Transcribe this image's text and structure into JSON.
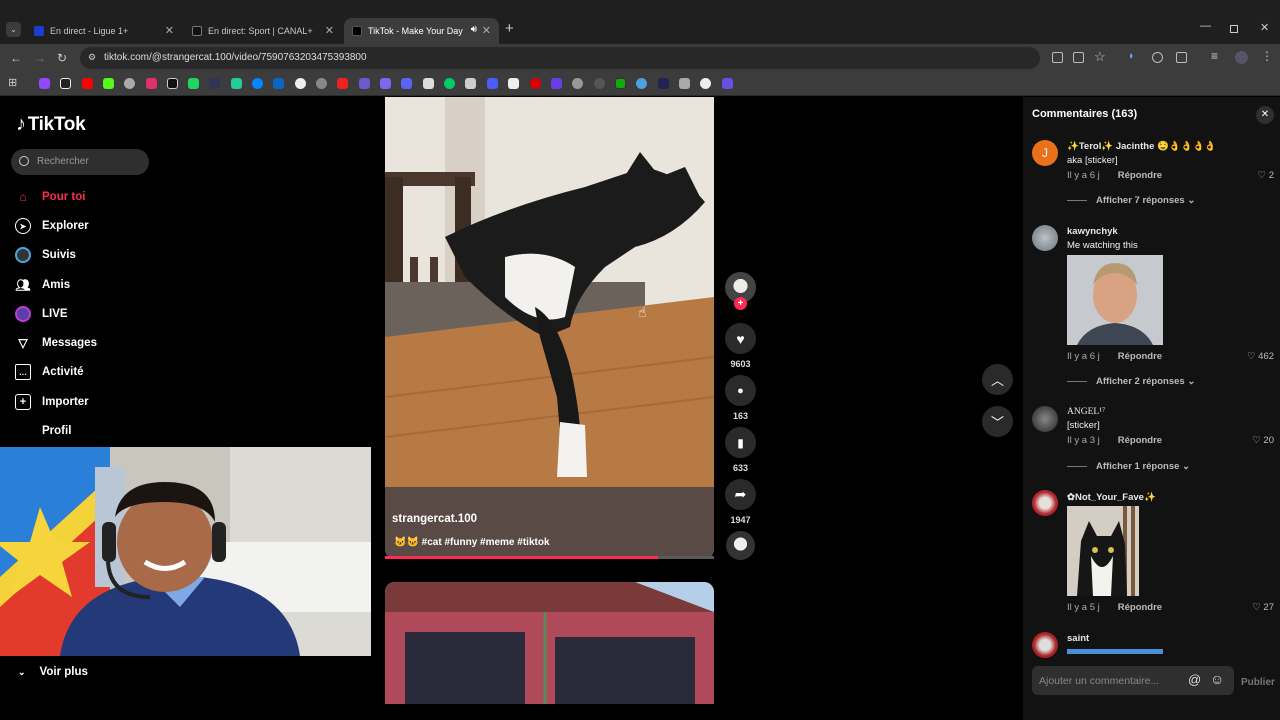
{
  "browser": {
    "tabs": [
      {
        "title": "En direct - Ligue 1+"
      },
      {
        "title": "En direct: Sport | CANAL+"
      },
      {
        "title": "TikTok - Make Your Day"
      }
    ],
    "new_tab": "+",
    "url": "tiktok.com/@strangercat.100/video/7590763203475393800"
  },
  "sidebar": {
    "logo": "TikTok",
    "search_placeholder": "Rechercher",
    "nav": [
      {
        "label": "Pour toi",
        "icon": "home-icon",
        "active": true
      },
      {
        "label": "Explorer",
        "icon": "compass-icon"
      },
      {
        "label": "Suivis",
        "icon": "following-avatar-icon"
      },
      {
        "label": "Amis",
        "icon": "friends-icon"
      },
      {
        "label": "LIVE",
        "icon": "live-icon"
      },
      {
        "label": "Messages",
        "icon": "send-icon"
      },
      {
        "label": "Activité",
        "icon": "activity-icon"
      },
      {
        "label": "Importer",
        "icon": "plus-square-icon"
      },
      {
        "label": "Profil",
        "icon": "profile-icon"
      }
    ],
    "voir_plus": "Voir plus"
  },
  "video": {
    "username": "strangercat.100",
    "caption": "🐱🐱 #cat #funny #meme #tiktok",
    "progress": 0.83,
    "likes": "9603",
    "comments": "163",
    "saves": "633",
    "shares": "1947"
  },
  "comments_panel": {
    "title": "Commentaires (163)",
    "reply_label": "Répondre",
    "items": [
      {
        "name": "✨Terol✨ Jacinthe 🤤👌👌👌👌",
        "text": "aka [sticker]",
        "time": "Il y a 6 j",
        "likes": "2",
        "avatar_letter": "J",
        "replies": "Afficher 7 réponses"
      },
      {
        "name": "kawynchyk",
        "text": "Me watching this",
        "time": "Il y a 6 j",
        "likes": "462",
        "replies": "Afficher 2 réponses"
      },
      {
        "name": "ANGEL¹⁷",
        "text": "[sticker]",
        "time": "Il y a 3 j",
        "likes": "20",
        "replies": "Afficher 1 réponse"
      },
      {
        "name": "✿Not_Your_Fave✨",
        "text": "",
        "time": "Il y a 5 j",
        "likes": "27"
      },
      {
        "name": "saint",
        "text": ""
      }
    ],
    "input_placeholder": "Ajouter un commentaire...",
    "publish": "Publier"
  }
}
